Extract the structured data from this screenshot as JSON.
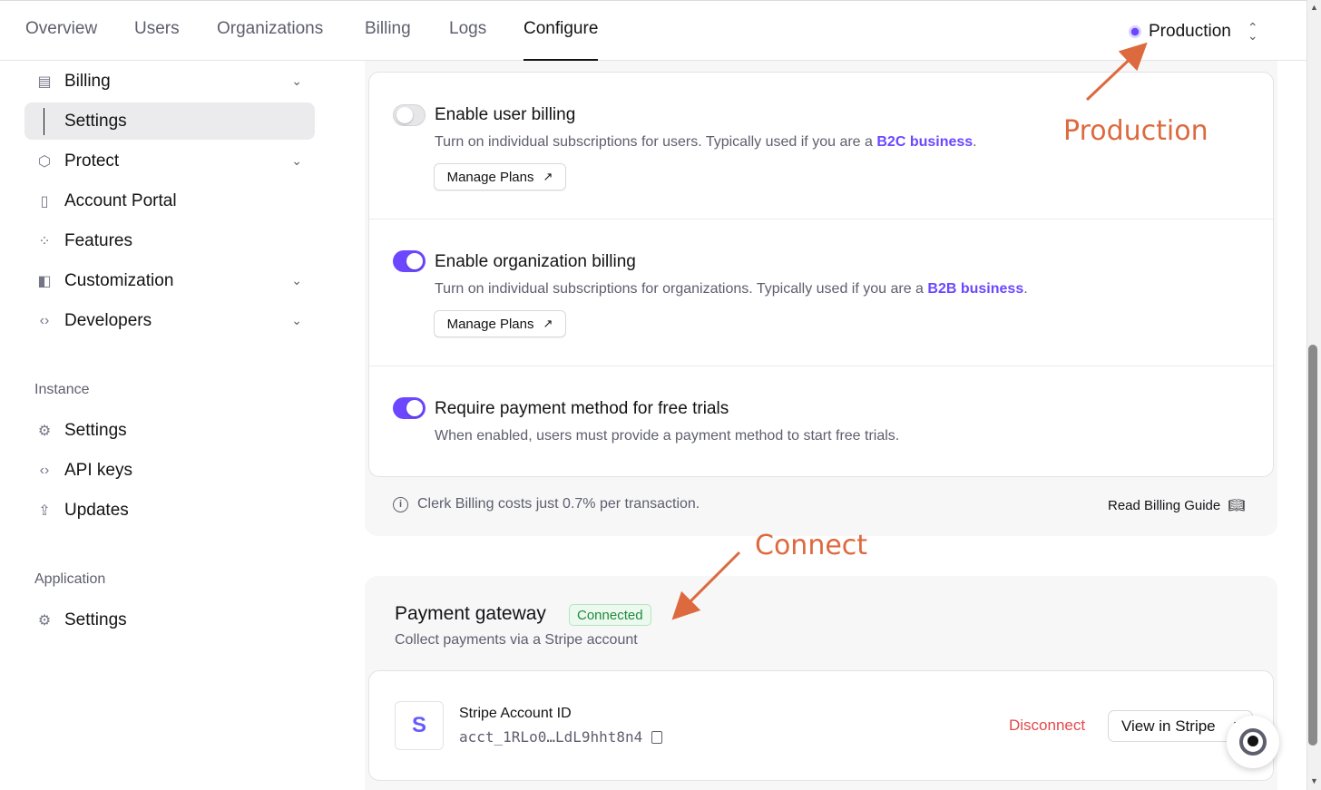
{
  "topnav": {
    "tabs": [
      {
        "label": "Overview"
      },
      {
        "label": "Users"
      },
      {
        "label": "Organizations"
      },
      {
        "label": "Billing"
      },
      {
        "label": "Logs"
      },
      {
        "label": "Configure",
        "active": true
      }
    ],
    "environment": "Production"
  },
  "sidebar": {
    "items": [
      {
        "label": "Billing",
        "icon": "billing-icon"
      },
      {
        "label": "Settings",
        "selected": true
      },
      {
        "label": "Protect",
        "icon": "shield-icon"
      },
      {
        "label": "Account Portal",
        "icon": "door-icon"
      },
      {
        "label": "Features",
        "icon": "grid-icon"
      },
      {
        "label": "Customization",
        "icon": "palette-icon"
      },
      {
        "label": "Developers",
        "icon": "code-icon"
      }
    ],
    "instance_heading": "Instance",
    "instance_items": [
      {
        "label": "Settings",
        "icon": "gear-icon"
      },
      {
        "label": "API keys",
        "icon": "code-icon"
      },
      {
        "label": "Updates",
        "icon": "upload-icon"
      }
    ],
    "application_heading": "Application",
    "application_items": [
      {
        "label": "Settings",
        "icon": "gear-icon"
      }
    ]
  },
  "billing": {
    "rows": [
      {
        "title": "Enable user billing",
        "desc_prefix": "Turn on individual subscriptions for users. Typically used if you are a ",
        "link": "B2C business",
        "desc_suffix": ".",
        "enabled": false,
        "button": "Manage Plans"
      },
      {
        "title": "Enable organization billing",
        "desc_prefix": "Turn on individual subscriptions for organizations. Typically used if you are a ",
        "link": "B2B business",
        "desc_suffix": ".",
        "enabled": true,
        "button": "Manage Plans"
      },
      {
        "title": "Require payment method for free trials",
        "desc_prefix": "When enabled, users must provide a payment method to start free trials.",
        "enabled": true
      }
    ],
    "footer_note": "Clerk Billing costs just 0.7% per transaction.",
    "guide_link": "Read Billing Guide"
  },
  "gateway": {
    "title": "Payment gateway",
    "status": "Connected",
    "subtitle": "Collect payments via a Stripe account",
    "logo_letter": "S",
    "account_label": "Stripe Account ID",
    "account_id": "acct_1RLo0…LdL9hht8n4",
    "disconnect": "Disconnect",
    "view": "View in Stripe"
  },
  "annotations": {
    "production": "Production",
    "connect": "Connect"
  },
  "colors": {
    "accent": "#6c47ff",
    "annotation": "#dd6a3e",
    "danger": "#e5484d",
    "success": "#1f8a3b"
  }
}
